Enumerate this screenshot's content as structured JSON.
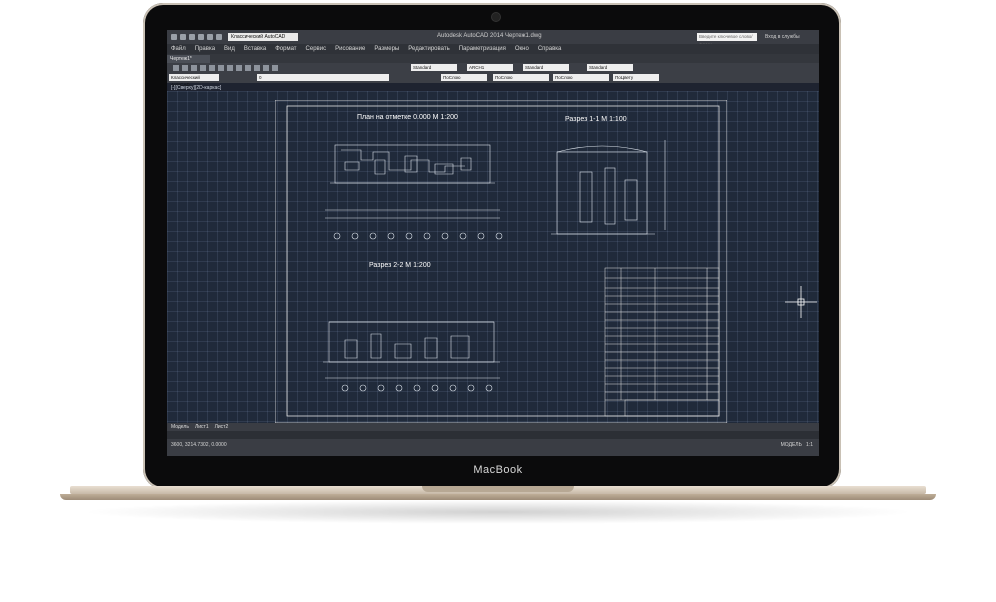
{
  "laptop": {
    "brand": "MacBook"
  },
  "window": {
    "title": "Autodesk AutoCAD 2014   Чертеж1.dwg",
    "workspace": "Классический AutoCAD",
    "search_placeholder": "Введите ключевое слово/фразу",
    "signin": "Вход в службы"
  },
  "menu": [
    "Файл",
    "Правка",
    "Вид",
    "Вставка",
    "Формат",
    "Сервис",
    "Рисование",
    "Размеры",
    "Редактировать",
    "Параметризация",
    "Окно",
    "Справка"
  ],
  "doc_tab": "Чертеж1*",
  "toolbars": {
    "text_style": "Standard",
    "dim_style": "ARCH1",
    "table_style": "Standard",
    "mleader_style": "Standard",
    "workspace_combo": "Классический AutoCAD",
    "layer": "0",
    "color": "ПоСлою",
    "linetype": "ПоСлою",
    "lineweight": "ПоСлою",
    "plotstyle": "ПоЦвету"
  },
  "viewport_label": "[-][Сверху][2D-каркас]",
  "drawing": {
    "plan_title": "План на отметке 0.000 М 1:200",
    "section11_title": "Разрез 1-1 М 1:100",
    "section22_title": "Разрез 2-2 М 1:200"
  },
  "layout_tabs": [
    "Модель",
    "Лист1",
    "Лист2"
  ],
  "status": {
    "coords": "3600, 3214.7302, 0.0000",
    "model": "МОДЕЛЬ",
    "scale": "1:1"
  },
  "colors": {
    "accent": "#ffffff",
    "canvas": "#202a3a"
  }
}
